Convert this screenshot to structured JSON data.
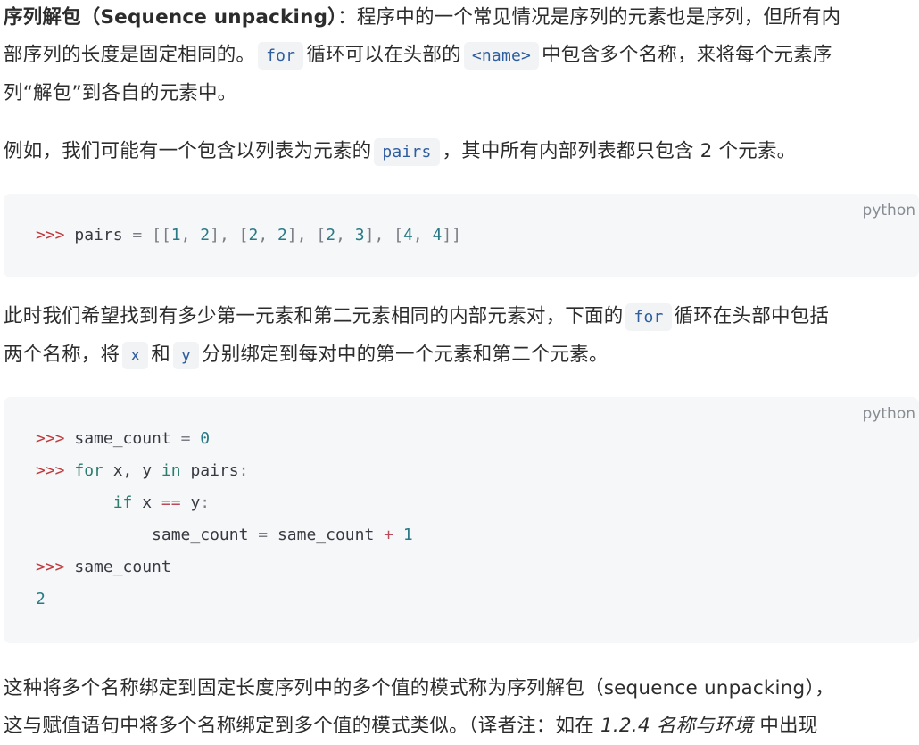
{
  "p1": {
    "term": "序列解包（Sequence unpacking）",
    "t1": "：程序中的一个常见情况是序列的元素也是序列，但所有内",
    "t2": "部序列的长度是固定相同的。",
    "code_for": "for",
    "t3": "循环可以在头部的",
    "code_name": "<name>",
    "t4": "中包含多个名称，来将每个元素序",
    "t5": "列“解包”到各自的元素中。"
  },
  "p2": {
    "t1": "例如，我们可能有一个包含以列表为元素的",
    "code_pairs": "pairs",
    "t2": "，其中所有内部列表都只包含 2 个元素。"
  },
  "code1": {
    "lang": "python",
    "prompt": ">>>",
    "var": "pairs",
    "eq": "=",
    "open": "[[",
    "n1": "1",
    "n2": "2",
    "n3": "2",
    "n4": "2",
    "n5": "2",
    "n6": "3",
    "n7": "4",
    "n8": "4",
    "close": "]]",
    "mid": "], ["
  },
  "p3": {
    "t1": "此时我们希望找到有多少第一元素和第二元素相同的内部元素对，下面的",
    "code_for": "for",
    "t2": "循环在头部中包括",
    "t3": "两个名称，将",
    "code_x": "x",
    "t4": "和",
    "code_y": "y",
    "t5": "分别绑定到每对中的第一个元素和第二个元素。"
  },
  "code2": {
    "lang": "python",
    "prompt": ">>>",
    "l1_var": "same_count",
    "l1_eq": "=",
    "l1_val": "0",
    "l2_for": "for",
    "l2_targets": "x, y",
    "l2_in": "in",
    "l2_iter": "pairs",
    "l2_colon": ":",
    "l3_if": "if",
    "l3_x": "x",
    "l3_op": "==",
    "l3_y": "y",
    "l3_colon": ":",
    "l4_var": "same_count",
    "l4_eq": "=",
    "l4_expr": "same_count",
    "l4_plus": "+",
    "l4_one": "1",
    "l5_var": "same_count",
    "output": "2"
  },
  "p4": {
    "t1": "这种将多个名称绑定到固定长度序列中的多个值的模式称为序列解包（sequence unpacking），",
    "t2": "这与赋值语句中将多个名称绑定到多个值的模式类似。（译者注：如在",
    "ref": "1.2.4 名称与环境",
    "t3": "中出现"
  }
}
